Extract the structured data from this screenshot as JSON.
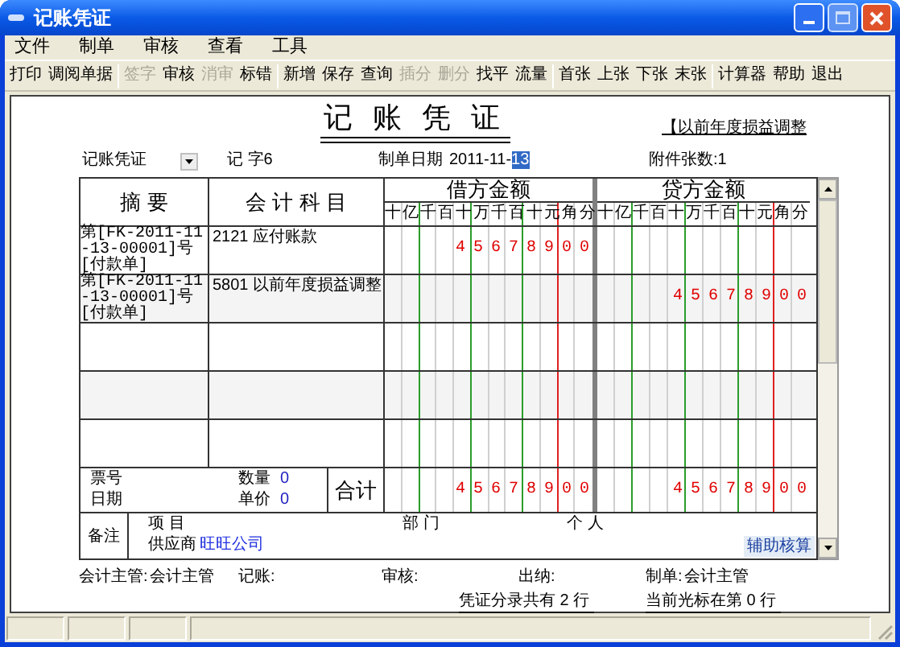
{
  "window": {
    "title": "记账凭证"
  },
  "menu": [
    "文件",
    "制单",
    "审核",
    "查看",
    "工具"
  ],
  "toolbar": [
    [
      {
        "label": "打印",
        "disabled": false
      },
      {
        "label": "调阅单据",
        "disabled": false
      }
    ],
    [
      {
        "label": "签字",
        "disabled": true
      },
      {
        "label": "审核",
        "disabled": false
      },
      {
        "label": "消审",
        "disabled": true
      },
      {
        "label": "标错",
        "disabled": false
      }
    ],
    [
      {
        "label": "新增",
        "disabled": false
      },
      {
        "label": "保存",
        "disabled": false
      },
      {
        "label": "查询",
        "disabled": false
      },
      {
        "label": "插分",
        "disabled": true
      },
      {
        "label": "删分",
        "disabled": true
      },
      {
        "label": "找平",
        "disabled": false
      },
      {
        "label": "流量",
        "disabled": false
      }
    ],
    [
      {
        "label": "首张",
        "disabled": false
      },
      {
        "label": "上张",
        "disabled": false
      },
      {
        "label": "下张",
        "disabled": false
      },
      {
        "label": "末张",
        "disabled": false
      }
    ],
    [
      {
        "label": "计算器",
        "disabled": false
      },
      {
        "label": "帮助",
        "disabled": false
      },
      {
        "label": "退出",
        "disabled": false
      }
    ]
  ],
  "voucher": {
    "title": "记 账 凭 证",
    "note": "【以前年度损益调整",
    "type": "记账凭证",
    "number": "记 字6",
    "date_label": "制单日期",
    "date": "2011-11-",
    "date_selected": "13",
    "attachments": "附件张数:1",
    "columns": [
      {
        "label": "摘 要"
      },
      {
        "label": "会 计 科 目"
      },
      {
        "label": "借方金额",
        "digits": "十亿千百十万千百十元角分"
      },
      {
        "label": "贷方金额",
        "digits": "十亿千百十万千百十元角分"
      }
    ],
    "rows": [
      {
        "kind": "entry",
        "summary": "第[FK-2011-11-13-00001]号[付款单]",
        "account": "2121 应付账款",
        "debit": "45678900"
      },
      {
        "kind": "entry",
        "summary": "第[FK-2011-11-13-00001]号[付款单]",
        "account": "5801 以前年度损益调整",
        "credit": "45678900"
      },
      {
        "kind": "blank"
      },
      {
        "kind": "blank"
      },
      {
        "kind": "blank"
      }
    ],
    "total": {
      "ticket_label": "票号",
      "date_label": "日期",
      "quantity_label": "数量",
      "quantity": "0",
      "price_label": "单价",
      "price": "0",
      "label": "合计",
      "debit": "45678900",
      "credit": "45678900"
    },
    "remarks": {
      "label": "备注",
      "project_label": "项 目",
      "department_label": "部 门",
      "person_label": "个 人",
      "supplier_label": "供应商",
      "supplier": "旺旺公司",
      "button": "辅助核算"
    }
  },
  "signatures": [
    {
      "label": "会计主管:",
      "value": "会计主管"
    },
    {
      "label": "记账:"
    },
    {
      "label": "审核:"
    },
    {
      "label": "出纳:"
    },
    {
      "label": "制单:",
      "value": "会计主管"
    }
  ],
  "entry_count": "凭证分录共有 2 行",
  "cursor_row": "当前光标在第 0 行"
}
